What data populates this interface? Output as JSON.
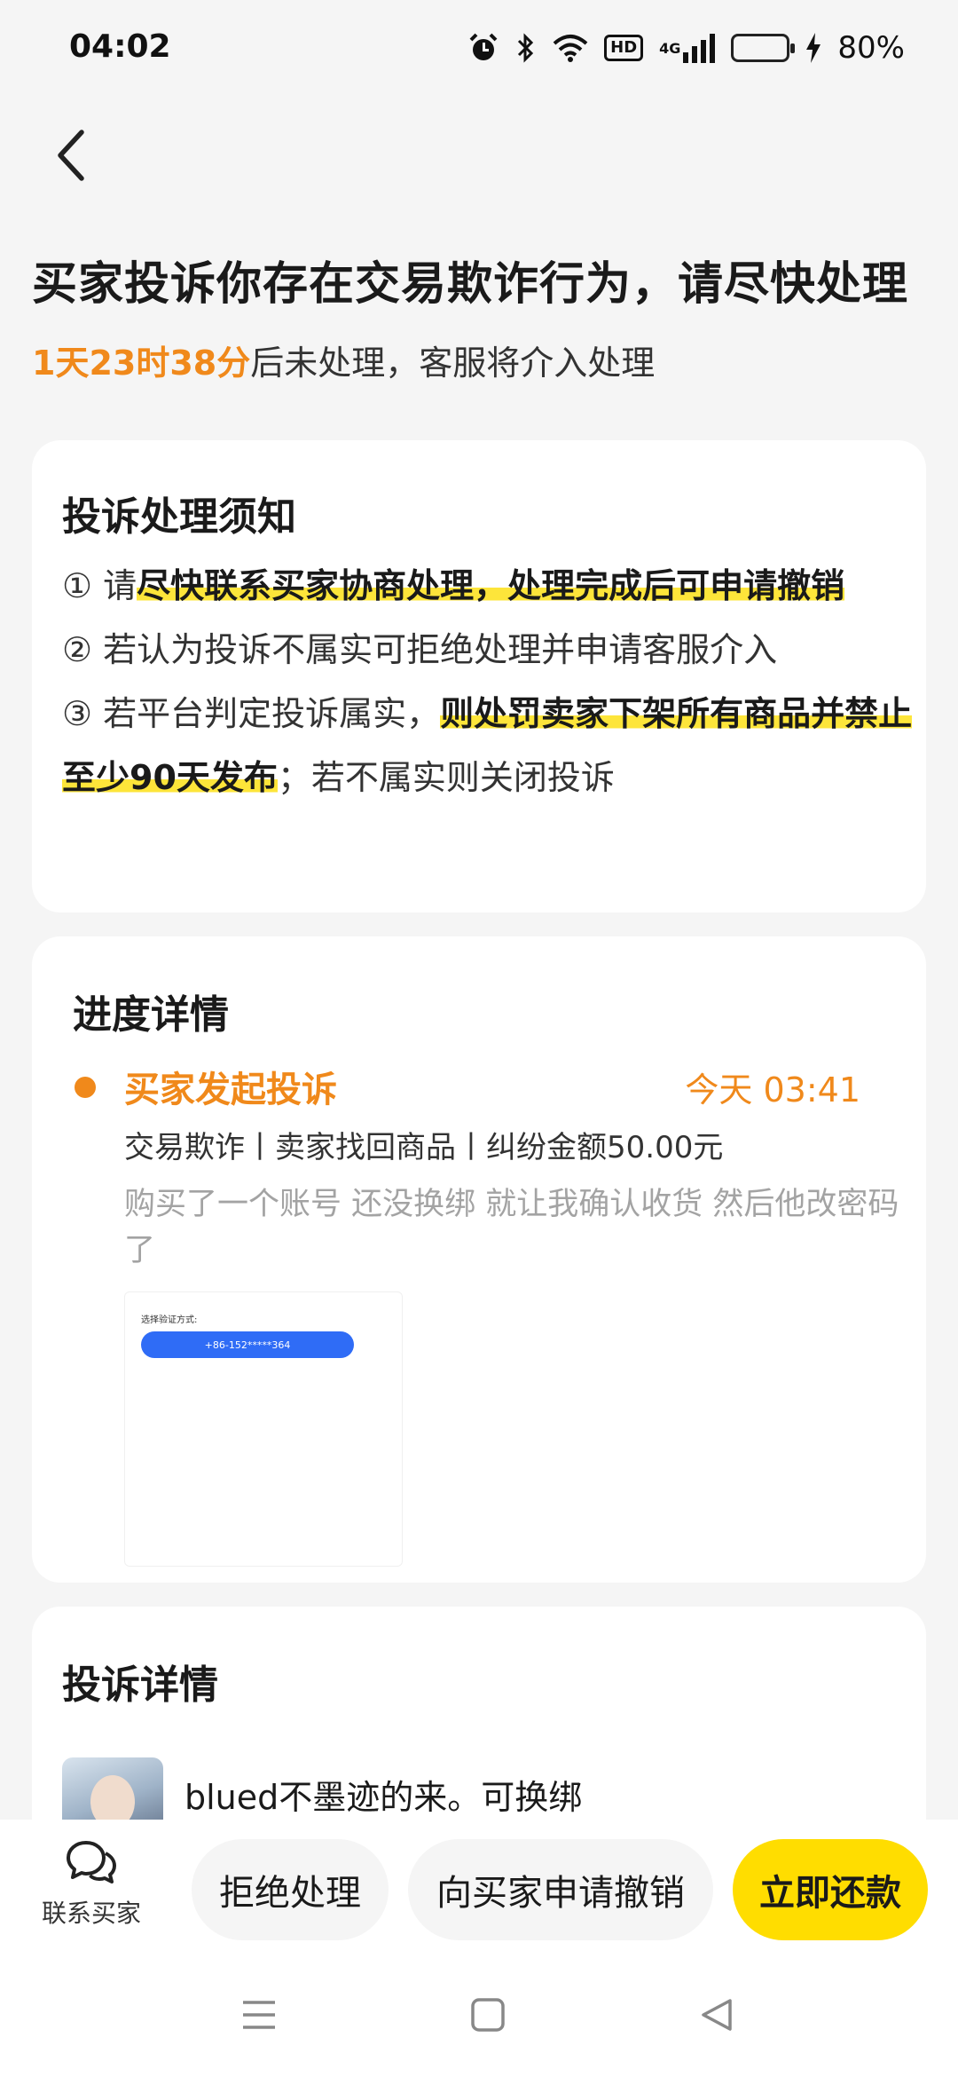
{
  "status_bar": {
    "time": "04:02",
    "hd": "HD",
    "network": "4G",
    "battery_percent": 80,
    "battery_text": "80%",
    "icons": [
      "alarm-icon",
      "bluetooth-icon",
      "wifi-icon",
      "hd-icon",
      "signal-icon",
      "battery-icon",
      "charging-icon"
    ]
  },
  "header": {
    "title": "买家投诉你存在交易欺诈行为，请尽快处理",
    "countdown": "1天23时38分",
    "deadline_suffix": "后未处理，客服将介入处理"
  },
  "notice": {
    "title": "投诉处理须知",
    "item1_prefix": "① 请",
    "item1_highlight": "尽快联系买家协商处理，处理完成后可申请撤销",
    "item2": "② 若认为投诉不属实可拒绝处理并申请客服介入",
    "item3_prefix": "③ 若平台判定投诉属实，",
    "item3_highlight": "则处罚卖家下架所有商品并禁止至少90天发布",
    "item3_suffix": "；若不属实则关闭投诉"
  },
  "progress": {
    "title": "进度详情",
    "event_title": "买家发起投诉",
    "event_time": "今天 03:41",
    "event_meta": "交易欺诈丨卖家找回商品丨纠纷金额50.00元",
    "event_desc": "购买了一个账号 还没换绑 就让我确认收货 然后他改密码了",
    "evidence_label": "选择验证方式:",
    "evidence_phone": "+86-152*****364"
  },
  "complaint": {
    "title": "投诉详情",
    "user_name": "blued不墨迹的来。可换绑"
  },
  "actions": {
    "contact_label": "联系买家",
    "reject_label": "拒绝处理",
    "revoke_label": "向买家申请撤销",
    "refund_label": "立即还款"
  },
  "colors": {
    "accent_orange": "#f0891b",
    "highlight_yellow": "#fde53a",
    "primary_button": "#ffdd00",
    "evidence_blue": "#2f6cf6"
  }
}
